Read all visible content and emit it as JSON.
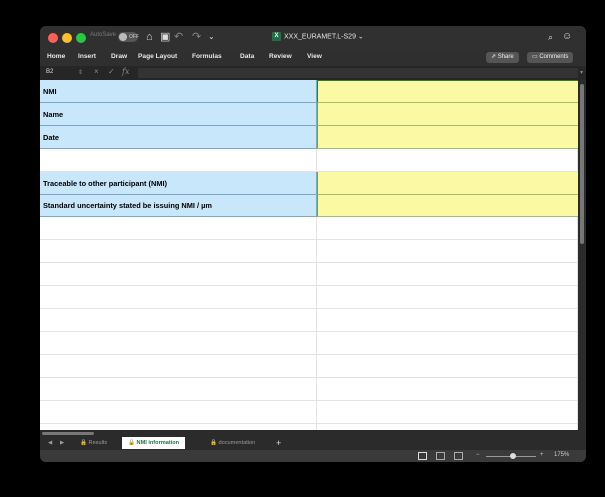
{
  "window": {
    "autosave_label": "AutoSave",
    "autosave_state": "OFF",
    "title": "XXX_EURAMET.L-S29",
    "traffic_colors": [
      "#ff5f57",
      "#febc2e",
      "#28c840"
    ]
  },
  "menu": [
    "Home",
    "Insert",
    "Draw",
    "Page Layout",
    "Formulas",
    "Data",
    "Review",
    "View"
  ],
  "toolbar": {
    "share": "Share",
    "comments": "Comments"
  },
  "formula_bar": {
    "cell_ref": "B2",
    "fx": "fx",
    "content": ""
  },
  "sheet": {
    "rows": [
      {
        "label": "NMI",
        "value": "",
        "style": "filled"
      },
      {
        "label": "Name",
        "value": "",
        "style": "filled"
      },
      {
        "label": "Date",
        "value": "",
        "style": "filled"
      },
      {
        "label": "",
        "value": "",
        "style": "empty"
      },
      {
        "label": "Traceable to other participant (NMI)",
        "value": "",
        "style": "filled"
      },
      {
        "label": "Standard uncertainty stated be issuing NMI / µm",
        "value": "",
        "style": "filled"
      }
    ],
    "colors": {
      "label_fill": "#c9e7fb",
      "value_fill": "#fbf9a3"
    }
  },
  "tabs": [
    {
      "label": "Results",
      "active": false,
      "locked": true
    },
    {
      "label": "NMI information",
      "active": true,
      "locked": true
    },
    {
      "label": "documentation",
      "active": false,
      "locked": true
    }
  ],
  "status": {
    "zoom": "175%",
    "zoom_minus": "−",
    "zoom_plus": "+"
  }
}
